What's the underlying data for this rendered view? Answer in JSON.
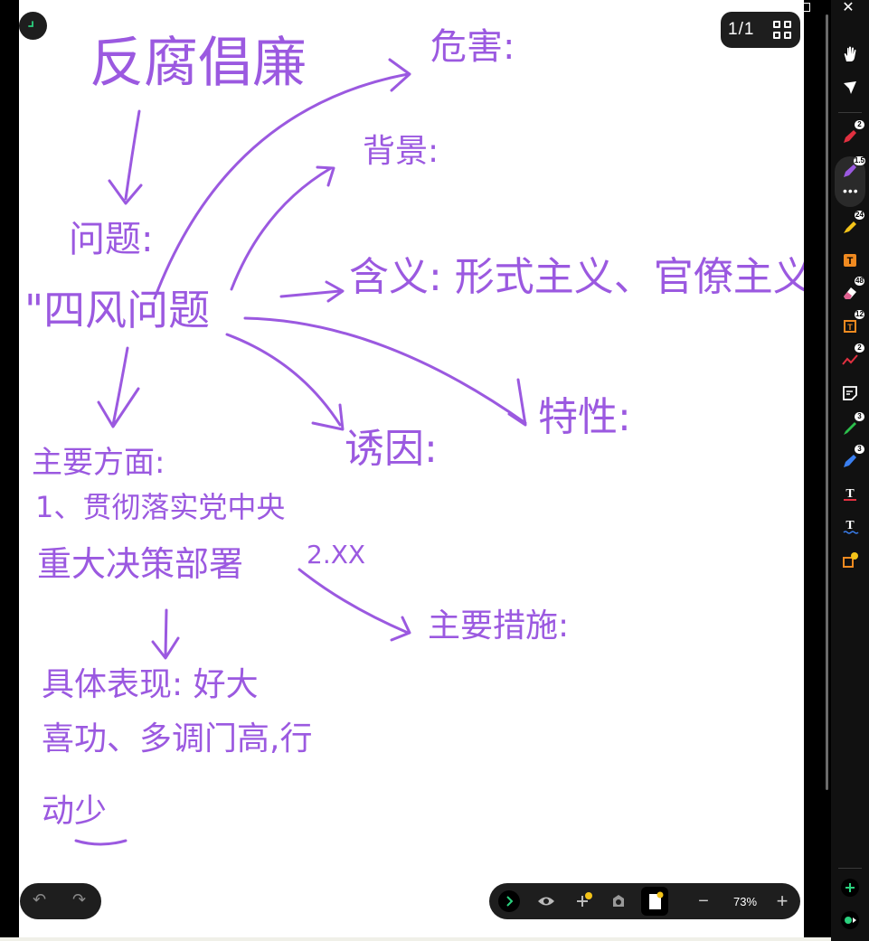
{
  "page_indicator": {
    "current": "1",
    "separator": "/",
    "total": "1"
  },
  "zoom": {
    "value": "73%"
  },
  "canvas": {
    "notes": {
      "title": "反腐倡廉",
      "harm": "危害:",
      "background": "背景:",
      "problem": "问题:",
      "four_winds": "\"四风问题",
      "meaning": "含义: 形式主义、官僚主义",
      "features": "特性:",
      "causes": "诱因:",
      "main_aspects": "主要方面:",
      "item1_line1": "1、贯彻落实党中央",
      "item1_line2": "重大决策部署",
      "item2": "2.XX",
      "main_measures": "主要措施:",
      "manifest_line1": "具体表现: 好大",
      "manifest_line2": "喜功、多调门高,行",
      "manifest_line3": "动少"
    }
  },
  "toolbar": {
    "badges": {
      "pen_red": "2",
      "pen_purple": "1.5",
      "highlighter": "24",
      "eraser": "48",
      "text_box": "12",
      "line": "2",
      "pen_green": "3",
      "pen_blue": "3"
    }
  },
  "colors": {
    "ink": "#9b59e0",
    "ui_dark": "#1e1e1e"
  }
}
